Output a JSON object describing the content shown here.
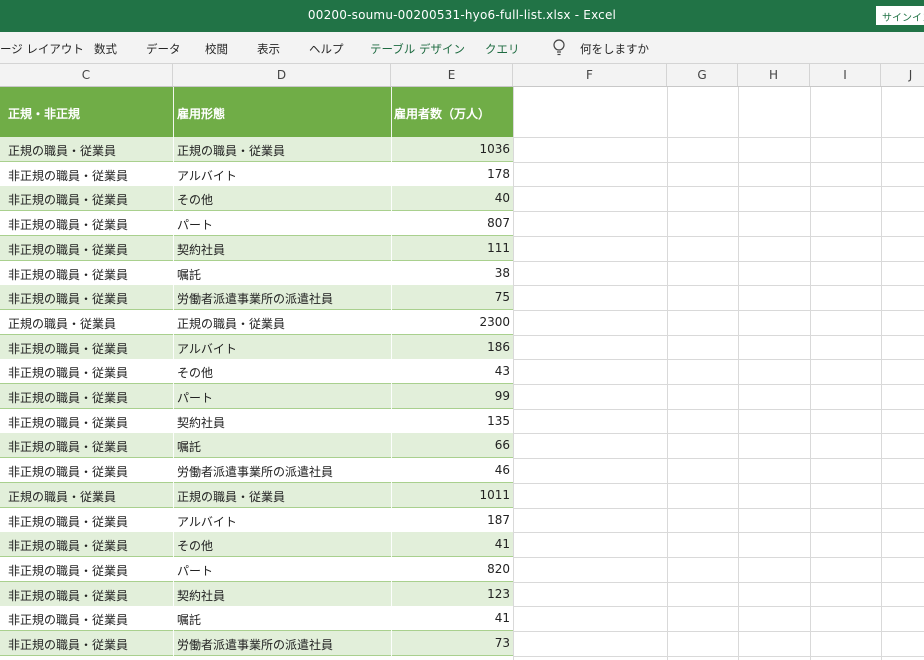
{
  "window": {
    "title": "00200-soumu-00200531-hyo6-full-list.xlsx  -  Excel",
    "signin": "サインイン"
  },
  "ribbon": {
    "tabs": [
      "ージ レイアウト",
      "数式",
      "データ",
      "校閲",
      "表示",
      "ヘルプ"
    ],
    "context_tabs": [
      "テーブル デザイン",
      "クエリ"
    ],
    "tell_me": "何をしますか"
  },
  "columns": [
    "C",
    "D",
    "E",
    "F",
    "G",
    "H",
    "I",
    "J"
  ],
  "table": {
    "headers": [
      "正規・非正規",
      "雇用形態",
      "雇用者数（万人）"
    ],
    "rows": [
      [
        "正規の職員・従業員",
        "正規の職員・従業員",
        "1036"
      ],
      [
        "非正規の職員・従業員",
        "アルバイト",
        "178"
      ],
      [
        "非正規の職員・従業員",
        "その他",
        "40"
      ],
      [
        "非正規の職員・従業員",
        "パート",
        "807"
      ],
      [
        "非正規の職員・従業員",
        "契約社員",
        "111"
      ],
      [
        "非正規の職員・従業員",
        "嘱託",
        "38"
      ],
      [
        "非正規の職員・従業員",
        "労働者派遣事業所の派遣社員",
        "75"
      ],
      [
        "正規の職員・従業員",
        "正規の職員・従業員",
        "2300"
      ],
      [
        "非正規の職員・従業員",
        "アルバイト",
        "186"
      ],
      [
        "非正規の職員・従業員",
        "その他",
        "43"
      ],
      [
        "非正規の職員・従業員",
        "パート",
        "99"
      ],
      [
        "非正規の職員・従業員",
        "契約社員",
        "135"
      ],
      [
        "非正規の職員・従業員",
        "嘱託",
        "66"
      ],
      [
        "非正規の職員・従業員",
        "労働者派遣事業所の派遣社員",
        "46"
      ],
      [
        "正規の職員・従業員",
        "正規の職員・従業員",
        "1011"
      ],
      [
        "非正規の職員・従業員",
        "アルバイト",
        "187"
      ],
      [
        "非正規の職員・従業員",
        "その他",
        "41"
      ],
      [
        "非正規の職員・従業員",
        "パート",
        "820"
      ],
      [
        "非正規の職員・従業員",
        "契約社員",
        "123"
      ],
      [
        "非正規の職員・従業員",
        "嘱託",
        "41"
      ],
      [
        "非正規の職員・従業員",
        "労働者派遣事業所の派遣社員",
        "73"
      ]
    ]
  },
  "colors": {
    "titlebar": "#217346",
    "table_header": "#70ad47",
    "band": "#e2efda"
  }
}
